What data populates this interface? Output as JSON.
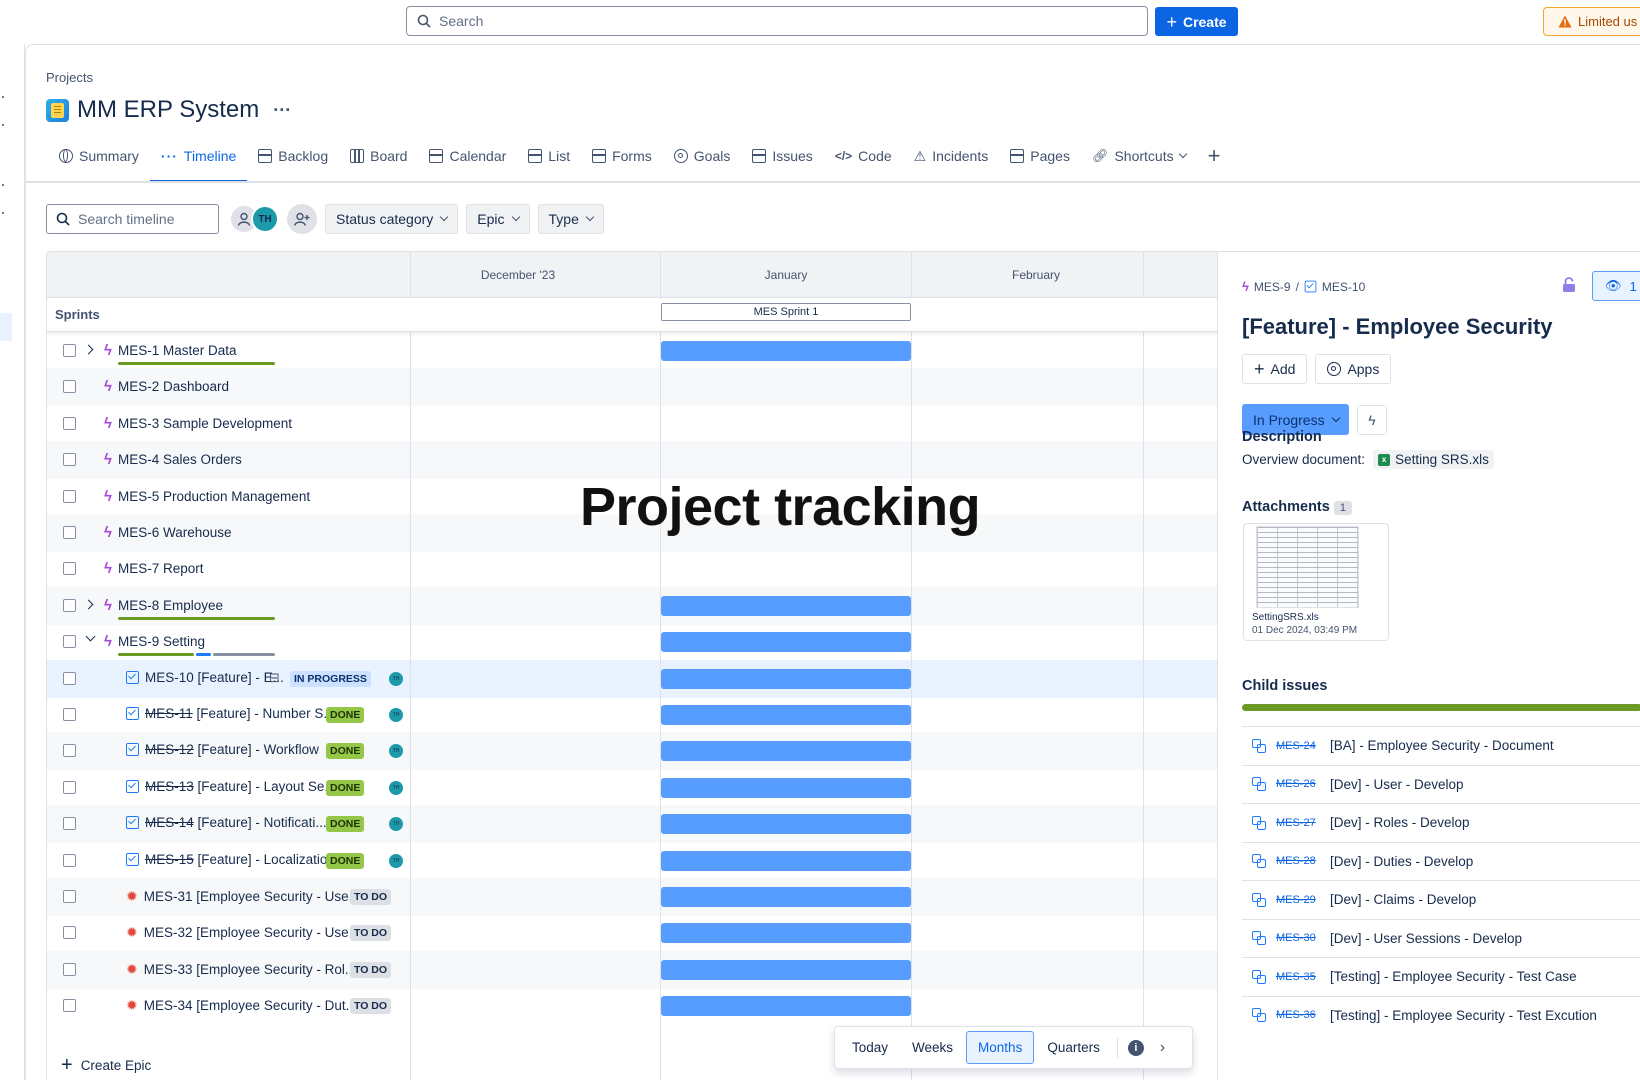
{
  "topbar": {
    "search_placeholder": "Search",
    "create_label": "Create",
    "limited_label": "Limited us"
  },
  "project": {
    "breadcrumb": "Projects",
    "title": "MM ERP System",
    "more": "···"
  },
  "tabs": [
    {
      "label": "Summary",
      "icon": "globe-icon"
    },
    {
      "label": "Timeline",
      "icon": "timeline-icon",
      "active": true
    },
    {
      "label": "Backlog",
      "icon": "backlog-icon"
    },
    {
      "label": "Board",
      "icon": "board-icon"
    },
    {
      "label": "Calendar",
      "icon": "calendar-icon"
    },
    {
      "label": "List",
      "icon": "list-icon"
    },
    {
      "label": "Forms",
      "icon": "forms-icon"
    },
    {
      "label": "Goals",
      "icon": "goals-icon"
    },
    {
      "label": "Issues",
      "icon": "issues-icon"
    },
    {
      "label": "Code",
      "icon": "code-icon"
    },
    {
      "label": "Incidents",
      "icon": "incidents-icon"
    },
    {
      "label": "Pages",
      "icon": "pages-icon"
    },
    {
      "label": "Shortcuts",
      "icon": "link-icon"
    }
  ],
  "filters": {
    "search_placeholder": "Search timeline",
    "avatar_initials": "TH",
    "status_category": "Status category",
    "epic": "Epic",
    "type": "Type"
  },
  "timeline": {
    "months": [
      "December '23",
      "January",
      "February"
    ],
    "sprints_label": "Sprints",
    "sprint_name": "MES Sprint 1",
    "create_epic": "Create Epic",
    "rows": [
      {
        "key": "MES-1",
        "summary": "Master Data",
        "kind": "epic",
        "expand": "right",
        "bar": true
      },
      {
        "key": "MES-2",
        "summary": "Dashboard",
        "kind": "epic"
      },
      {
        "key": "MES-3",
        "summary": "Sample Development",
        "kind": "epic"
      },
      {
        "key": "MES-4",
        "summary": "Sales Orders",
        "kind": "epic"
      },
      {
        "key": "MES-5",
        "summary": "Production Management",
        "kind": "epic"
      },
      {
        "key": "MES-6",
        "summary": "Warehouse",
        "kind": "epic"
      },
      {
        "key": "MES-7",
        "summary": "Report",
        "kind": "epic"
      },
      {
        "key": "MES-8",
        "summary": "Employee",
        "kind": "epic",
        "expand": "right",
        "bar": true
      },
      {
        "key": "MES-9",
        "summary": "Setting",
        "kind": "epic",
        "expand": "down",
        "bar": true
      },
      {
        "key": "MES-10",
        "summary": "[Feature] - E...",
        "kind": "task",
        "status": "IN PROGRESS",
        "bar": true
      },
      {
        "key": "MES-11",
        "summary": "[Feature] - Number S...",
        "kind": "task",
        "status": "DONE",
        "bar": true
      },
      {
        "key": "MES-12",
        "summary": "[Feature] - Workflow",
        "kind": "task",
        "status": "DONE",
        "bar": true
      },
      {
        "key": "MES-13",
        "summary": "[Feature] - Layout Se...",
        "kind": "task",
        "status": "DONE",
        "bar": true
      },
      {
        "key": "MES-14",
        "summary": "[Feature] - Notificati...",
        "kind": "task",
        "status": "DONE",
        "bar": true
      },
      {
        "key": "MES-15",
        "summary": "[Feature] - Localization",
        "kind": "task",
        "status": "DONE",
        "bar": true
      },
      {
        "key": "MES-31",
        "summary": "[Employee Security - Use...",
        "kind": "bug",
        "status": "TO DO",
        "bar": true
      },
      {
        "key": "MES-32",
        "summary": "[Employee Security - Use...",
        "kind": "bug",
        "status": "TO DO",
        "bar": true
      },
      {
        "key": "MES-33",
        "summary": "[Employee Security - Rol...",
        "kind": "bug",
        "status": "TO DO",
        "bar": true
      },
      {
        "key": "MES-34",
        "summary": "[Employee Security - Dut...",
        "kind": "bug",
        "status": "TO DO",
        "bar": true
      }
    ]
  },
  "overlay_text": "Project tracking",
  "zoom": {
    "options": [
      "Today",
      "Weeks",
      "Months",
      "Quarters"
    ],
    "selected": "Months"
  },
  "panel": {
    "parent_key": "MES-9",
    "issue_key": "MES-10",
    "watch_count": "1",
    "title": "[Feature] - Employee Security",
    "add_label": "Add",
    "apps_label": "Apps",
    "status": "In Progress",
    "description_heading": "Description",
    "description_text": "Overview document:",
    "description_file": "Setting SRS.xls",
    "attachments_heading": "Attachments",
    "attachments_count": "1",
    "attachment_name": "SettingSRS.xls",
    "attachment_date": "01 Dec 2024, 03:49 PM",
    "child_heading": "Child issues",
    "children": [
      {
        "key": "MES-24",
        "summary": "[BA] - Employee Security - Document"
      },
      {
        "key": "MES-26",
        "summary": "[Dev] - User - Develop"
      },
      {
        "key": "MES-27",
        "summary": "[Dev] - Roles - Develop"
      },
      {
        "key": "MES-28",
        "summary": "[Dev] - Duties - Develop"
      },
      {
        "key": "MES-29",
        "summary": "[Dev] - Claims - Develop"
      },
      {
        "key": "MES-30",
        "summary": "[Dev] - User Sessions - Develop"
      },
      {
        "key": "MES-35",
        "summary": "[Testing] - Employee Security - Test Case"
      },
      {
        "key": "MES-36",
        "summary": "[Testing] - Employee Security - Test Excution"
      }
    ]
  },
  "colors": {
    "brand_blue": "#0c66e4",
    "bar_blue": "#579dff",
    "done_green": "#94c748",
    "epic_purple": "#a54bd8",
    "bug_red": "#e2483d"
  }
}
